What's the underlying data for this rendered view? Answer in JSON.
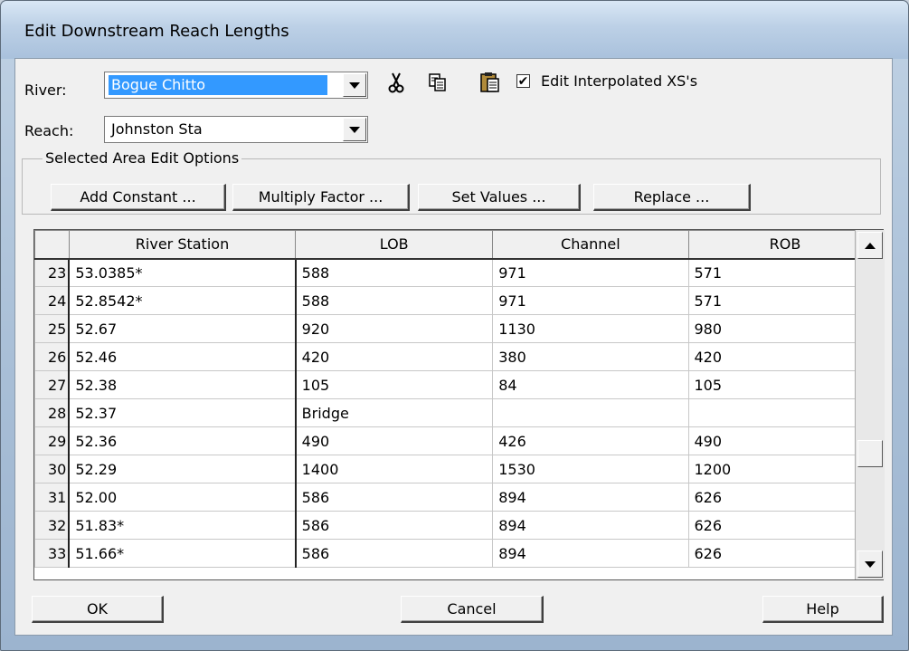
{
  "window": {
    "title": "Edit Downstream Reach Lengths"
  },
  "river": {
    "label": "River:",
    "value": "Bogue Chitto"
  },
  "reach": {
    "label": "Reach:",
    "value": "Johnston Sta"
  },
  "toolbar": {
    "cut_icon": "scissors-icon",
    "copy_icon": "copy-icon",
    "paste_icon": "clipboard-icon",
    "edit_interpolated_label": "Edit Interpolated XS's",
    "edit_interpolated_checked": true
  },
  "edit_options": {
    "legend": "Selected Area Edit Options",
    "add_constant": "Add Constant ...",
    "multiply_factor": "Multiply Factor ...",
    "set_values": "Set Values ...",
    "replace": "Replace ..."
  },
  "table": {
    "headers": [
      "",
      "River Station",
      "LOB",
      "Channel",
      "ROB"
    ],
    "rows": [
      [
        "23",
        "53.0385*",
        "588",
        "971",
        "571"
      ],
      [
        "24",
        "52.8542*",
        "588",
        "971",
        "571"
      ],
      [
        "25",
        "52.67",
        "920",
        "1130",
        "980"
      ],
      [
        "26",
        "52.46",
        "420",
        "380",
        "420"
      ],
      [
        "27",
        "52.38",
        "105",
        "84",
        "105"
      ],
      [
        "28",
        "52.37",
        "Bridge",
        "",
        ""
      ],
      [
        "29",
        "52.36",
        "490",
        "426",
        "490"
      ],
      [
        "30",
        "52.29",
        "1400",
        "1530",
        "1200"
      ],
      [
        "31",
        "52.00",
        "586",
        "894",
        "626"
      ],
      [
        "32",
        "51.83*",
        "586",
        "894",
        "626"
      ],
      [
        "33",
        "51.66*",
        "586",
        "894",
        "626"
      ]
    ]
  },
  "footer": {
    "ok": "OK",
    "cancel": "Cancel",
    "help": "Help"
  }
}
